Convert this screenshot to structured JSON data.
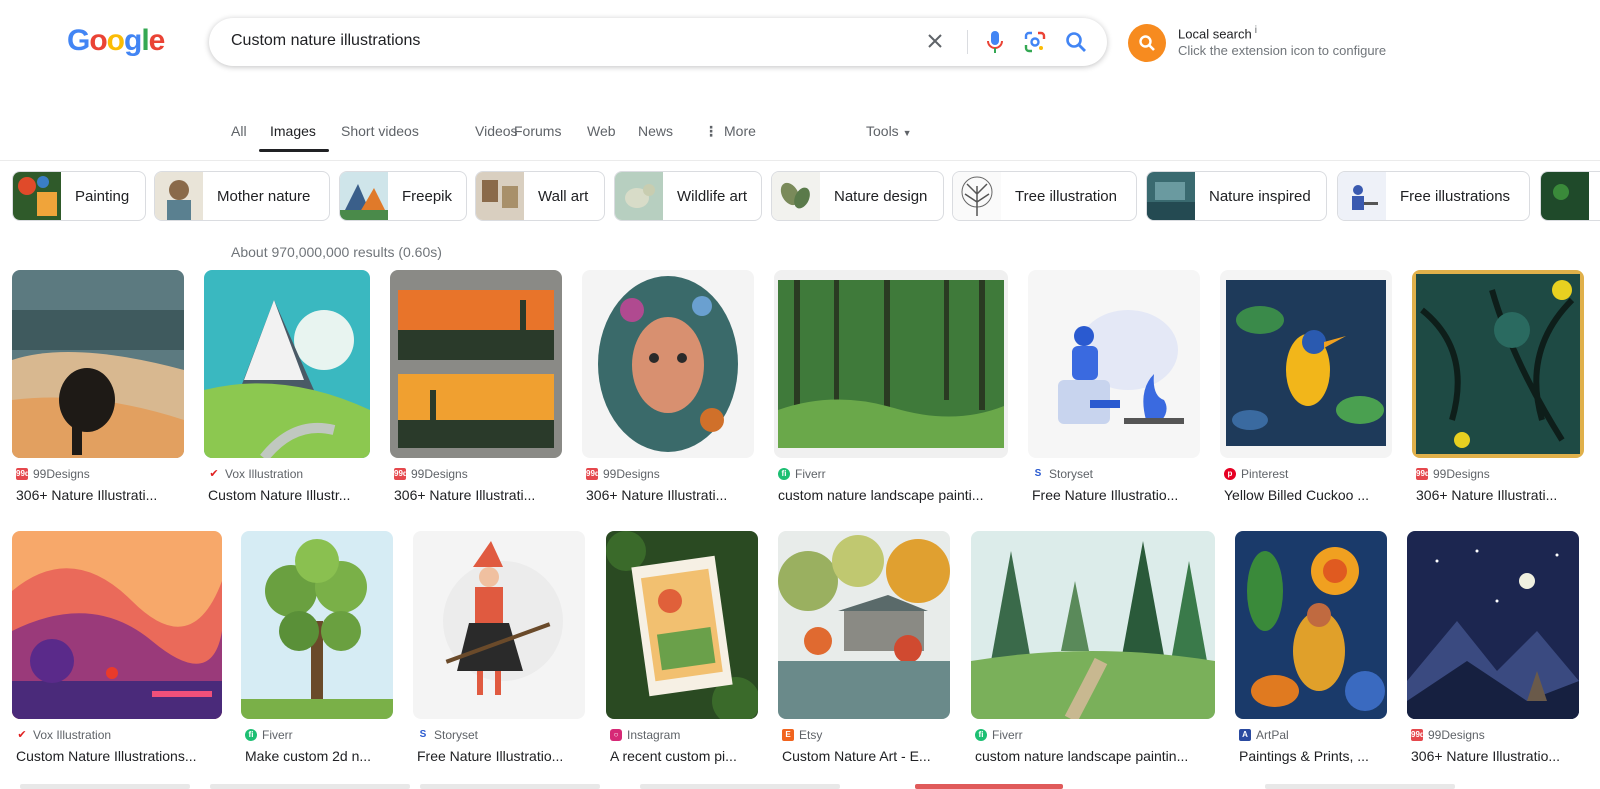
{
  "logo": {
    "letters": [
      "G",
      "o",
      "o",
      "g",
      "l",
      "e"
    ],
    "colors": [
      "#4285F4",
      "#EA4335",
      "#FBBC05",
      "#4285F4",
      "#34A853",
      "#EA4335"
    ]
  },
  "search": {
    "query": "Custom nature illustrations"
  },
  "extension": {
    "title": "Local search",
    "info": "i",
    "subtitle": "Click the extension icon to configure"
  },
  "tabs": [
    {
      "label": "All"
    },
    {
      "label": "Images"
    },
    {
      "label": "Short videos"
    },
    {
      "label": "Videos"
    },
    {
      "label": "Forums"
    },
    {
      "label": "Web"
    },
    {
      "label": "News"
    },
    {
      "label": "More"
    }
  ],
  "tools": "Tools",
  "chips": [
    {
      "label": "Painting"
    },
    {
      "label": "Mother nature"
    },
    {
      "label": "Freepik"
    },
    {
      "label": "Wall art"
    },
    {
      "label": "Wildlife art"
    },
    {
      "label": "Nature design"
    },
    {
      "label": "Tree illustration"
    },
    {
      "label": "Nature inspired"
    },
    {
      "label": "Free illustrations"
    }
  ],
  "stats": "About 970,000,000 results (0.60s)",
  "results_row1": [
    {
      "source": "99Designs",
      "title": "306+ Nature Illustrati..."
    },
    {
      "source": "Vox Illustration",
      "title": "Custom Nature Illustr..."
    },
    {
      "source": "99Designs",
      "title": "306+ Nature Illustrati..."
    },
    {
      "source": "99Designs",
      "title": "306+ Nature Illustrati..."
    },
    {
      "source": "Fiverr",
      "title": "custom nature landscape painti..."
    },
    {
      "source": "Storyset",
      "title": "Free Nature Illustratio..."
    },
    {
      "source": "Pinterest",
      "title": "Yellow Billed Cuckoo ..."
    },
    {
      "source": "99Designs",
      "title": "306+ Nature Illustrati..."
    }
  ],
  "results_row2": [
    {
      "source": "Vox Illustration",
      "title": "Custom Nature Illustrations..."
    },
    {
      "source": "Fiverr",
      "title": "Make custom 2d n..."
    },
    {
      "source": "Storyset",
      "title": "Free Nature Illustratio..."
    },
    {
      "source": "Instagram",
      "title": "A recent custom pi..."
    },
    {
      "source": "Etsy",
      "title": "Custom Nature Art - E..."
    },
    {
      "source": "Fiverr",
      "title": "custom nature landscape paintin..."
    },
    {
      "source": "ArtPal",
      "title": "Paintings & Prints, ..."
    },
    {
      "source": "99Designs",
      "title": "306+ Nature Illustratio..."
    }
  ],
  "favicons": {
    "99": "99d",
    "fiverr": "fi",
    "storyset": "S",
    "etsy": "E"
  }
}
